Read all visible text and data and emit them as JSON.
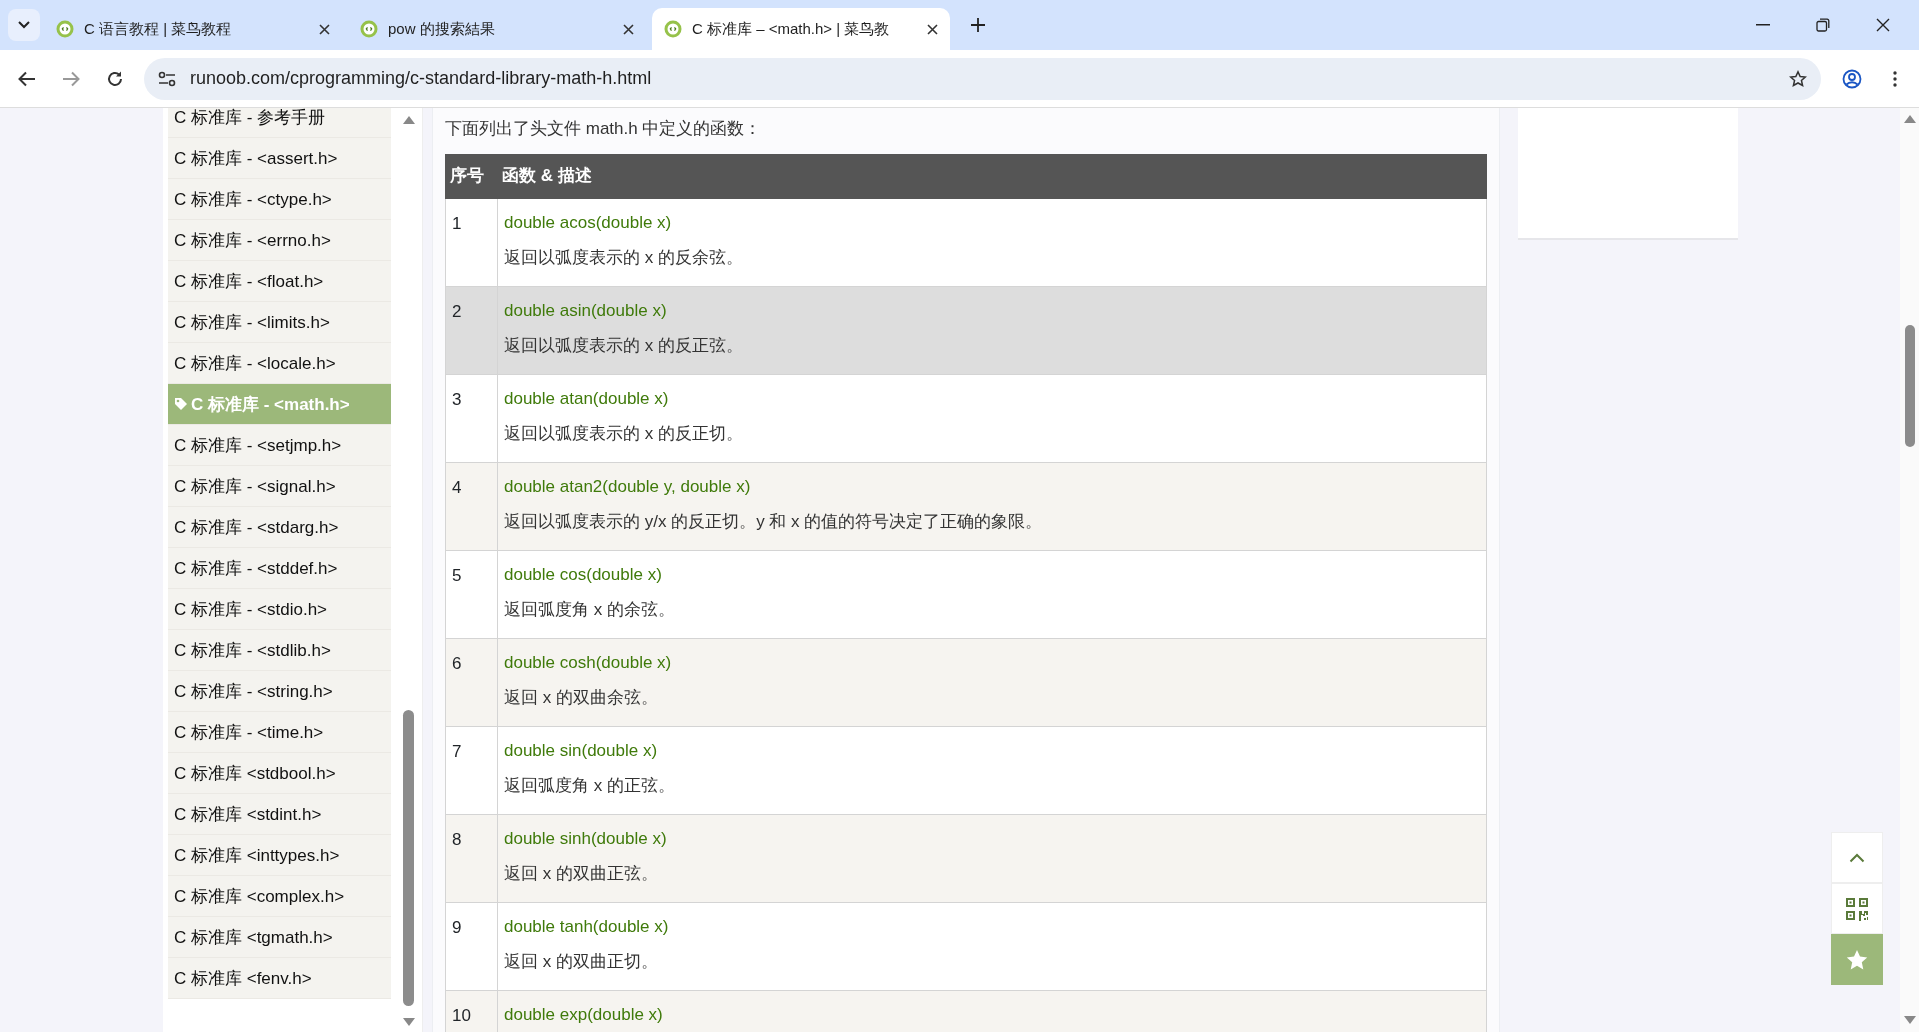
{
  "browser": {
    "tabs": [
      {
        "title": "C 语言教程 | 菜鸟教程",
        "selected": false
      },
      {
        "title": "pow 的搜索結果",
        "selected": false
      },
      {
        "title": "C 标准库 – <math.h> | 菜鸟教",
        "selected": true
      }
    ],
    "address": "runoob.com/cprogramming/c-standard-library-math-h.html"
  },
  "sidebar": {
    "items": [
      {
        "label": "C 标准库 - 参考手册",
        "selected": false
      },
      {
        "label": "C 标准库 - <assert.h>",
        "selected": false
      },
      {
        "label": "C 标准库 - <ctype.h>",
        "selected": false
      },
      {
        "label": "C 标准库 - <errno.h>",
        "selected": false
      },
      {
        "label": "C 标准库 - <float.h>",
        "selected": false
      },
      {
        "label": "C 标准库 - <limits.h>",
        "selected": false
      },
      {
        "label": "C 标准库 - <locale.h>",
        "selected": false
      },
      {
        "label": "C 标准库 - <math.h>",
        "selected": true
      },
      {
        "label": "C 标准库 - <setjmp.h>",
        "selected": false
      },
      {
        "label": "C 标准库 - <signal.h>",
        "selected": false
      },
      {
        "label": "C 标准库 - <stdarg.h>",
        "selected": false
      },
      {
        "label": "C 标准库 - <stddef.h>",
        "selected": false
      },
      {
        "label": "C 标准库 - <stdio.h>",
        "selected": false
      },
      {
        "label": "C 标准库 - <stdlib.h>",
        "selected": false
      },
      {
        "label": "C 标准库 - <string.h>",
        "selected": false
      },
      {
        "label": "C 标准库 - <time.h>",
        "selected": false
      },
      {
        "label": "C 标准库 <stdbool.h>",
        "selected": false
      },
      {
        "label": "C 标准库 <stdint.h>",
        "selected": false
      },
      {
        "label": "C 标准库 <inttypes.h>",
        "selected": false
      },
      {
        "label": "C 标准库 <complex.h>",
        "selected": false
      },
      {
        "label": "C 标准库 <tgmath.h>",
        "selected": false
      },
      {
        "label": "C 标准库 <fenv.h>",
        "selected": false
      }
    ]
  },
  "content": {
    "intro": "下面列出了头文件 math.h 中定义的函数：",
    "table": {
      "columns": [
        "序号",
        "函数 & 描述"
      ],
      "rows": [
        {
          "number": "1",
          "function": "double acos(double x)",
          "description": "返回以弧度表示的 x 的反余弦。",
          "highlighted": false
        },
        {
          "number": "2",
          "function": "double asin(double x)",
          "description": "返回以弧度表示的 x 的反正弦。",
          "highlighted": true
        },
        {
          "number": "3",
          "function": "double atan(double x)",
          "description": "返回以弧度表示的 x 的反正切。",
          "highlighted": false
        },
        {
          "number": "4",
          "function": "double atan2(double y, double x)",
          "description": "返回以弧度表示的 y/x 的反正切。y 和 x 的值的符号决定了正确的象限。",
          "highlighted": false
        },
        {
          "number": "5",
          "function": "double cos(double x)",
          "description": "返回弧度角 x 的余弦。",
          "highlighted": false
        },
        {
          "number": "6",
          "function": "double cosh(double x)",
          "description": "返回 x 的双曲余弦。",
          "highlighted": false
        },
        {
          "number": "7",
          "function": "double sin(double x)",
          "description": "返回弧度角 x 的正弦。",
          "highlighted": false
        },
        {
          "number": "8",
          "function": "double sinh(double x)",
          "description": "返回 x 的双曲正弦。",
          "highlighted": false
        },
        {
          "number": "9",
          "function": "double tanh(double x)",
          "description": "返回 x 的双曲正切。",
          "highlighted": false
        },
        {
          "number": "10",
          "function": "double exp(double x)",
          "highlighted": false
        }
      ]
    }
  }
}
